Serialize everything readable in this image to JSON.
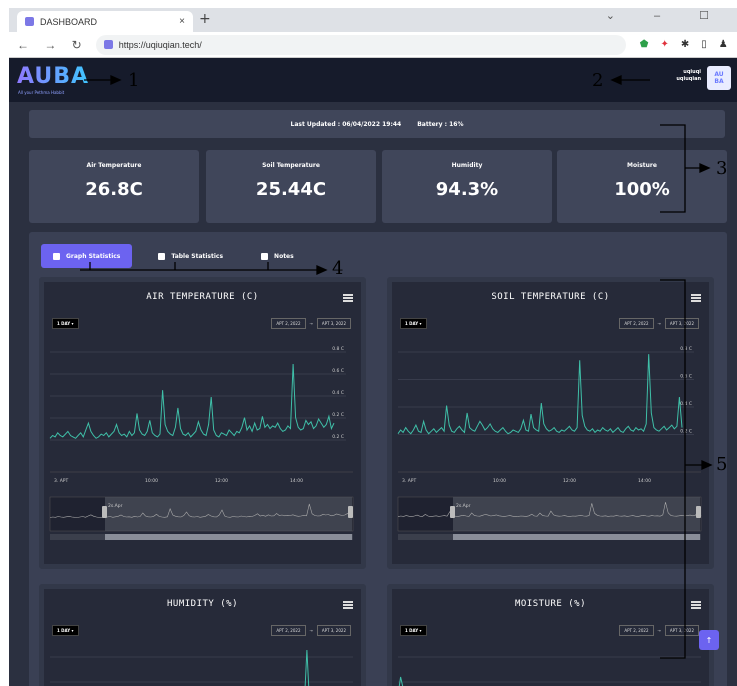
{
  "browser": {
    "tab_title": "DASHBOARD",
    "tab_close": "×",
    "new_tab": "+",
    "window_controls": "⌄ – ☐",
    "nav_buttons": "← → ↻",
    "url": "https://uqiuqian.tech/",
    "ext_icons": [
      "shield-icon",
      "extension-icon",
      "puzzle-icon",
      "sidebar-icon",
      "profile-icon"
    ]
  },
  "app": {
    "logo": "AUBA",
    "logo_tagline": "All your Pethma Habbit",
    "user_name": "uqiuqi",
    "user_handle": "uqiuqian",
    "avatar_text": "AU\nBA",
    "status": {
      "last_updated": "Last Updated : 06/04/2022 19:44",
      "battery": "Battery : 16%"
    },
    "cards": [
      {
        "label": "Air Temperature",
        "value": "26.8C"
      },
      {
        "label": "Soil Temperature",
        "value": "25.44C"
      },
      {
        "label": "Humidity",
        "value": "94.3%"
      },
      {
        "label": "Moisture",
        "value": "100%"
      }
    ],
    "tabs": [
      {
        "label": "Graph Statistics",
        "active": true,
        "icon": "bar-chart-icon"
      },
      {
        "label": "Table Statistics",
        "active": false,
        "icon": "table-icon"
      },
      {
        "label": "Notes",
        "active": false,
        "icon": "note-icon"
      }
    ],
    "range_button": "1 DAY ▾",
    "date_from": "APT 2, 2022",
    "date_arrow": "→",
    "date_to": "APT 3, 2022",
    "scroll_top": "↑",
    "accent": "#6c63f0",
    "line_color": "#3fbfa8"
  },
  "annotations": [
    "1",
    "2",
    "3",
    "4",
    "5"
  ],
  "chart_data": [
    {
      "type": "line",
      "title": "AIR TEMPERATURE (C)",
      "y_ticks": [
        "0.8 C",
        "0.6 C",
        "0.4 C",
        "0.2 C",
        "0.2 C"
      ],
      "x_ticks": [
        "3. APT",
        "10:00",
        "12:00",
        "14:00"
      ],
      "scroller_label": "2s.Apr",
      "values": [
        0.2,
        0.22,
        0.21,
        0.24,
        0.22,
        0.21,
        0.23,
        0.25,
        0.22,
        0.21,
        0.2,
        0.22,
        0.24,
        0.21,
        0.26,
        0.31,
        0.25,
        0.22,
        0.2,
        0.21,
        0.23,
        0.22,
        0.24,
        0.21,
        0.23,
        0.25,
        0.3,
        0.24,
        0.22,
        0.23,
        0.21,
        0.25,
        0.22,
        0.24,
        0.38,
        0.26,
        0.23,
        0.22,
        0.25,
        0.33,
        0.24,
        0.22,
        0.21,
        0.23,
        0.55,
        0.3,
        0.25,
        0.23,
        0.22,
        0.28,
        0.42,
        0.27,
        0.23,
        0.22,
        0.24,
        0.21,
        0.23,
        0.25,
        0.32,
        0.26,
        0.23,
        0.22,
        0.3,
        0.5,
        0.26,
        0.22,
        0.21,
        0.24,
        0.23,
        0.22,
        0.26,
        0.24,
        0.22,
        0.25,
        0.24,
        0.28,
        0.35,
        0.26,
        0.29,
        0.25,
        0.31,
        0.26,
        0.27,
        0.36,
        0.28,
        0.3,
        0.27,
        0.29,
        0.28,
        0.31,
        0.27,
        0.25,
        0.26,
        0.29,
        0.27,
        0.74,
        0.35,
        0.28,
        0.26,
        0.27,
        0.33,
        0.3,
        0.32,
        0.27,
        0.29,
        0.34,
        0.31,
        0.28,
        0.3,
        0.36,
        0.27,
        0.31
      ],
      "ylim": [
        0.1,
        0.9
      ]
    },
    {
      "type": "line",
      "title": "SOIL TEMPERATURE (C)",
      "y_ticks": [
        "0.8 C",
        "0.6 C",
        "0.4 C",
        "0.2 C"
      ],
      "x_ticks": [
        "3. APT",
        "10:00",
        "12:00",
        "14:00"
      ],
      "scroller_label": "2s.Apr",
      "values": [
        0.25,
        0.28,
        0.26,
        0.3,
        0.27,
        0.25,
        0.28,
        0.32,
        0.27,
        0.26,
        0.35,
        0.28,
        0.25,
        0.27,
        0.29,
        0.26,
        0.28,
        0.3,
        0.27,
        0.48,
        0.32,
        0.27,
        0.26,
        0.29,
        0.31,
        0.28,
        0.26,
        0.42,
        0.3,
        0.28,
        0.27,
        0.31,
        0.35,
        0.32,
        0.28,
        0.3,
        0.33,
        0.29,
        0.27,
        0.26,
        0.28,
        0.3,
        0.27,
        0.25,
        0.26,
        0.28,
        0.27,
        0.26,
        0.29,
        0.36,
        0.28,
        0.27,
        0.41,
        0.3,
        0.28,
        0.27,
        0.5,
        0.33,
        0.29,
        0.27,
        0.28,
        0.3,
        0.27,
        0.26,
        0.28,
        0.27,
        0.29,
        0.31,
        0.28,
        0.27,
        0.3,
        0.85,
        0.4,
        0.31,
        0.28,
        0.27,
        0.29,
        0.26,
        0.28,
        0.27,
        0.3,
        0.28,
        0.27,
        0.29,
        0.26,
        0.28,
        0.3,
        0.27,
        0.26,
        0.29,
        0.31,
        0.28,
        0.27,
        0.3,
        0.28,
        0.29,
        0.27,
        0.33,
        0.9,
        0.42,
        0.3,
        0.28,
        0.27,
        0.29,
        0.31,
        0.28,
        0.3,
        0.32,
        0.29,
        0.31,
        0.55,
        0.3
      ],
      "ylim": [
        0.1,
        1.0
      ]
    },
    {
      "type": "line",
      "title": "HUMIDITY (%)",
      "values": [
        0.05,
        0.05,
        0.06,
        0.05,
        0.05,
        0.06,
        0.05,
        0.05,
        0.05,
        0.06,
        0.05,
        0.05,
        0.05,
        0.06,
        0.05,
        0.05,
        0.05,
        0.06,
        0.05,
        0.05,
        0.06,
        0.05,
        0.05,
        0.05,
        0.05,
        0.06,
        0.05,
        0.05,
        0.05,
        0.06,
        0.05,
        0.05,
        0.05,
        0.06,
        0.05,
        0.05,
        0.05,
        0.06,
        0.05,
        0.05,
        0.05,
        0.06,
        0.05,
        0.05,
        0.05,
        0.06,
        0.05,
        0.05,
        0.05,
        0.06,
        0.05,
        0.05,
        0.05,
        0.05,
        0.06,
        0.05,
        0.05,
        0.05,
        0.05,
        0.06,
        0.05,
        0.05,
        0.05,
        0.06,
        0.05,
        0.05,
        0.05,
        0.06,
        0.05,
        0.05,
        0.05,
        0.06,
        0.05,
        0.05,
        0.05,
        0.06,
        0.05,
        0.05,
        0.05,
        0.06,
        0.05,
        0.05,
        0.05,
        0.06,
        0.05,
        0.05,
        0.05,
        0.06,
        0.05,
        0.05,
        0.05,
        0.06,
        0.05,
        0.05,
        0.05,
        0.06,
        0.05,
        0.95,
        0.05,
        0.05,
        0.05,
        0.06,
        0.05,
        0.05,
        0.05,
        0.06,
        0.05,
        0.05,
        0.05,
        0.06,
        0.05,
        0.05
      ],
      "ylim": [
        0,
        1
      ]
    },
    {
      "type": "line",
      "title": "MOISTURE (%)",
      "values": [
        0.2,
        0.5,
        0.3,
        0.2,
        0.2,
        0.2,
        0.2,
        0.2,
        0.2,
        0.2,
        0.2,
        0.2,
        0.2,
        0.2,
        0.2,
        0.2,
        0.2,
        0.2,
        0.2,
        0.2,
        0.2,
        0.2,
        0.2,
        0.2,
        0.2,
        0.2,
        0.2,
        0.2,
        0.2,
        0.2,
        0.2,
        0.2,
        0.2,
        0.2,
        0.2,
        0.2,
        0.2,
        0.2,
        0.2,
        0.2,
        0.2,
        0.2,
        0.2,
        0.2,
        0.2,
        0.2,
        0.2,
        0.2,
        0.2,
        0.2,
        0.2,
        0.2,
        0.2,
        0.2,
        0.2,
        0.2,
        0.2,
        0.2,
        0.2,
        0.2,
        0.2,
        0.2,
        0.2,
        0.2,
        0.2,
        0.2,
        0.2,
        0.2,
        0.2,
        0.2,
        0.2,
        0.2,
        0.2,
        0.2,
        0.2,
        0.2,
        0.2,
        0.2,
        0.2,
        0.2,
        0.2,
        0.2,
        0.2,
        0.2,
        0.2,
        0.2,
        0.2,
        0.2,
        0.2,
        0.2,
        0.2,
        0.2,
        0.2,
        0.2,
        0.2,
        0.2,
        0.2,
        0.2,
        0.2,
        0.2,
        0.2,
        0.2,
        0.2,
        0.2,
        0.2,
        0.2,
        0.2,
        0.2,
        0.2,
        0.2,
        0.2,
        0.2
      ],
      "ylim": [
        0,
        1
      ]
    }
  ]
}
